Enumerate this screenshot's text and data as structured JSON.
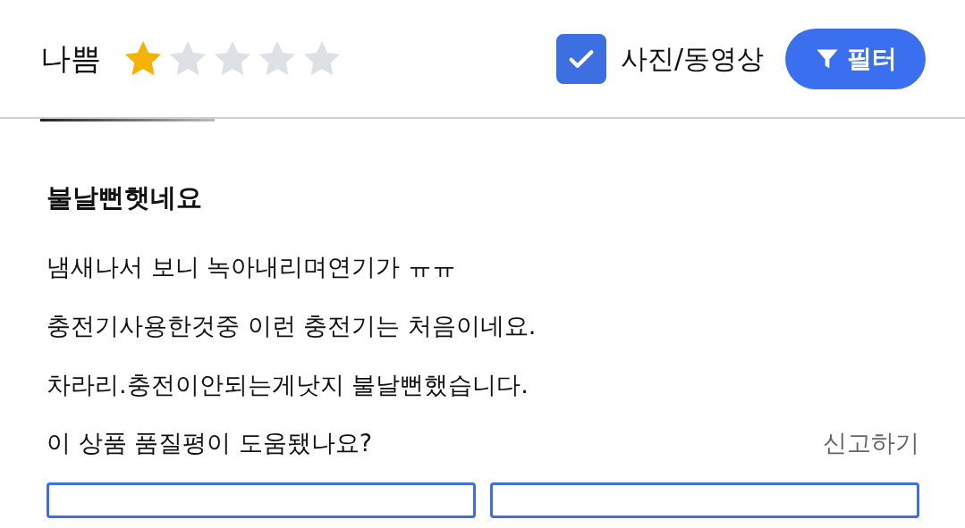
{
  "header": {
    "rating_label": "나쁨",
    "stars": 1,
    "photo_filter": {
      "label": "사진/동영상",
      "checked": true
    },
    "filter_button": {
      "label": "필터"
    }
  },
  "review": {
    "title": "불날뻔햇네요",
    "lines": [
      "냄새나서 보니 녹아내리며연기가 ㅠㅠ",
      "충전기사용한것중 이런 충전기는 처음이네요.",
      "차라리.충전이안되는게낫지 불날뻔했습니다."
    ],
    "helpful_question": "이 상품 품질평이 도움됐나요?",
    "report_link": "신고하기"
  }
}
